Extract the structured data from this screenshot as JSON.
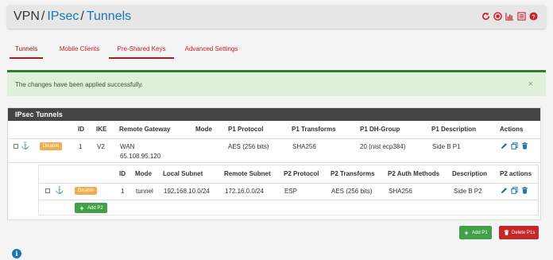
{
  "breadcrumb": {
    "part1": "VPN",
    "part2": "IPsec",
    "part3": "Tunnels",
    "sep": "/"
  },
  "header_icons": [
    "reload-icon",
    "stop-icon",
    "chart-icon",
    "list-icon",
    "help-icon"
  ],
  "tabs": [
    {
      "label": "Tunnels"
    },
    {
      "label": "Mobile Clients"
    },
    {
      "label": "Pre-Shared Keys"
    },
    {
      "label": "Advanced Settings"
    }
  ],
  "alert": {
    "message": "The changes have been applied successfully.",
    "close": "×"
  },
  "panel": {
    "title": "IPsec Tunnels",
    "columns": {
      "id": "ID",
      "ike": "IKE",
      "remote_gateway": "Remote Gateway",
      "mode": "Mode",
      "p1_protocol": "P1 Protocol",
      "p1_transforms": "P1 Transforms",
      "p1_dh_group": "P1 DH-Group",
      "p1_description": "P1 Description",
      "actions": "Actions"
    },
    "p1_row": {
      "disable_label": "Disable",
      "id": "1",
      "ike": "V2",
      "gateway_iface": "WAN",
      "gateway_ip": "65.108.95.120",
      "mode": "",
      "protocol": "AES (256 bits)",
      "transforms": "SHA256",
      "dh_group": "20 (nist ecp384)",
      "description": "Side B P1"
    },
    "p2_columns": {
      "id": "ID",
      "mode": "Mode",
      "local_subnet": "Local Subnet",
      "remote_subnet": "Remote Subnet",
      "p2_protocol": "P2 Protocol",
      "p2_transforms": "P2 Transforms",
      "p2_auth": "P2 Auth Methods",
      "description": "Description",
      "p2_actions": "P2 actions"
    },
    "p2_row": {
      "disable_label": "Disable",
      "id": "1",
      "mode": "tunnel",
      "local_subnet": "192.168.10.0/24",
      "remote_subnet": "172.16.0.0/24",
      "protocol": "ESP",
      "transforms": "AES (256 bits)",
      "auth": "SHA256",
      "description": "Side B P2"
    },
    "add_p2_label": "Add P2"
  },
  "footer_buttons": {
    "add_p1": "Add P1",
    "delete_p1s": "Delete P1s"
  },
  "colors": {
    "accent_red": "#c9202a",
    "link_blue": "#1a75b7",
    "success_green": "#43a047",
    "warning_orange": "#f0ad4e",
    "danger_red": "#c62828"
  }
}
